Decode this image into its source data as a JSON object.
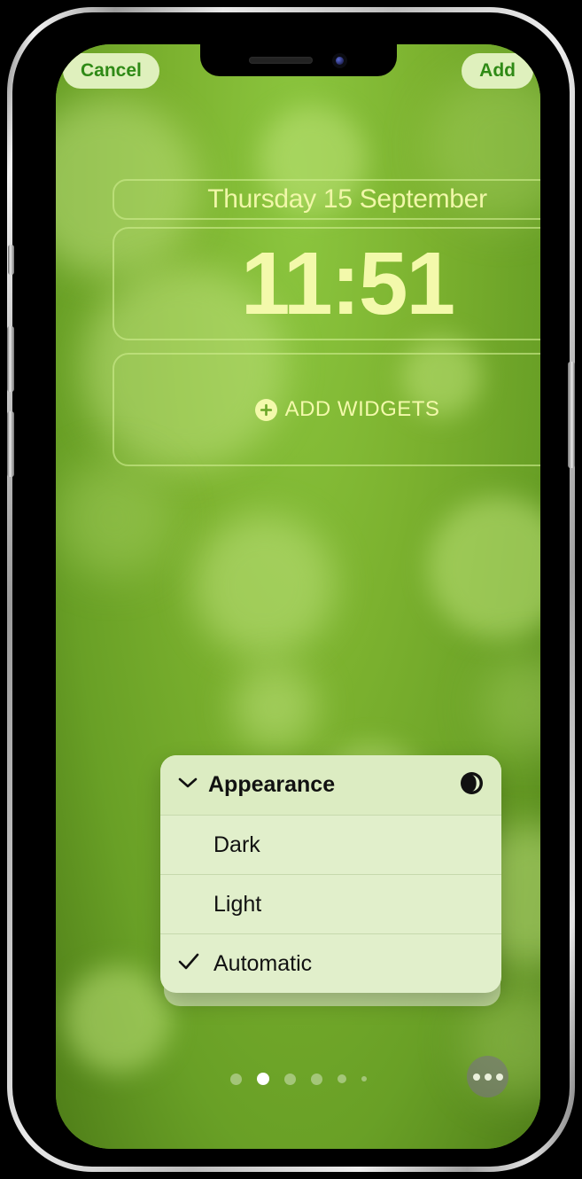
{
  "device": {
    "notch": {
      "speaker_icon": "speaker-grille-icon",
      "camera_icon": "front-camera-icon"
    }
  },
  "top_bar": {
    "cancel_label": "Cancel",
    "add_label": "Add"
  },
  "lock_screen": {
    "date_widget": "Thursday 15 September",
    "time_widget": "11:51",
    "add_widgets_label": "ADD WIDGETS",
    "plus_icon": "plus-circle-icon"
  },
  "appearance_menu": {
    "header_label": "Appearance",
    "header_chevron_icon": "chevron-down-icon",
    "mode_icon": "circle-righthalf-filled-icon",
    "check_icon": "checkmark-icon",
    "options": [
      {
        "label": "Dark",
        "selected": false
      },
      {
        "label": "Light",
        "selected": false
      },
      {
        "label": "Automatic",
        "selected": true
      }
    ]
  },
  "bottom": {
    "page_dots": {
      "count": 6,
      "active_index": 1,
      "sizes": [
        13,
        14,
        13,
        13,
        10,
        6
      ]
    },
    "more_button_icon": "ellipsis-icon"
  },
  "colors": {
    "wallpaper_green": "#7cb22f",
    "widget_text": "#f3f9ab",
    "button_pill_bg": "#dff0bd",
    "button_pill_text": "#2f8a16",
    "menu_bg": "#e1efcb",
    "menu_text": "#111111"
  }
}
